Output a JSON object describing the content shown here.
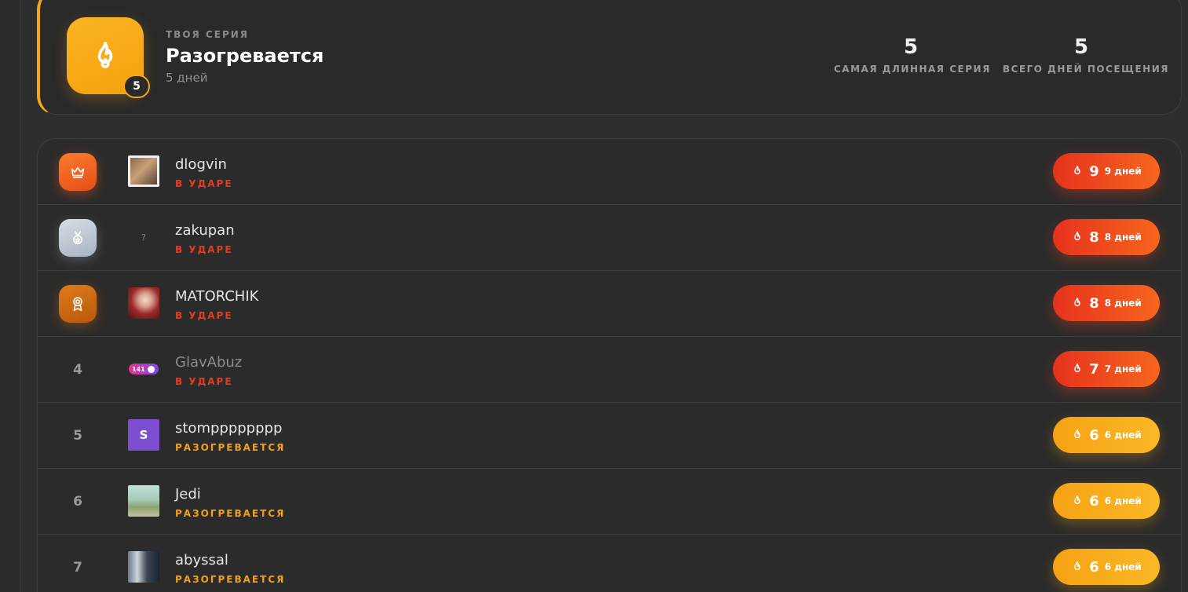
{
  "streak": {
    "eyebrow": "ТВОЯ СЕРИЯ",
    "title": "Разогревается",
    "subtitle": "5 дней",
    "badge": "5",
    "icon": "flame-icon",
    "accent": "#f5a614",
    "stats": [
      {
        "value": "5",
        "label": "САМАЯ ДЛИННАЯ СЕРИЯ"
      },
      {
        "value": "5",
        "label": "ВСЕГО ДНЕЙ ПОСЕЩЕНИЯ"
      }
    ]
  },
  "leaderboard": {
    "rows": [
      {
        "rank": "1",
        "rank_icon": "crown-icon",
        "username": "dlogvin",
        "status": "В УДАРЕ",
        "streak": "9",
        "days": "9 дней"
      },
      {
        "rank": "2",
        "rank_icon": "medal-icon",
        "username": "zakupan",
        "avatar_text": "?",
        "status": "В УДАРЕ",
        "streak": "8",
        "days": "8 дней"
      },
      {
        "rank": "3",
        "rank_icon": "award-icon",
        "username": "MATORCHIK",
        "status": "В УДАРЕ",
        "streak": "8",
        "days": "8 дней"
      },
      {
        "rank": "4",
        "username": "GlavAbuz",
        "avatar_text": "141",
        "status": "В УДАРЕ",
        "streak": "7",
        "days": "7 дней"
      },
      {
        "rank": "5",
        "username": "stompppppppp",
        "avatar_text": "S",
        "status": "РАЗОГРЕВАЕТСЯ",
        "streak": "6",
        "days": "6 дней"
      },
      {
        "rank": "6",
        "username": "Jedi",
        "status": "РАЗОГРЕВАЕТСЯ",
        "streak": "6",
        "days": "6 дней"
      },
      {
        "rank": "7",
        "username": "abyssal",
        "status": "РАЗОГРЕВАЕТСЯ",
        "streak": "6",
        "days": "6 дней"
      }
    ]
  },
  "colors": {
    "hot": "#e6321e",
    "warm": "#f5a214",
    "background": "#2e2e2e"
  }
}
